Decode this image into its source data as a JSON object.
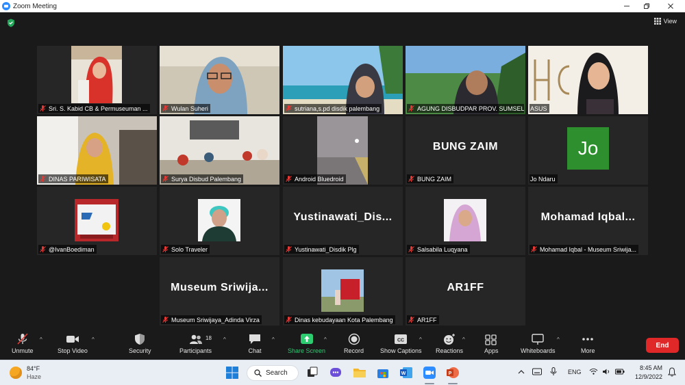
{
  "window": {
    "title": "Zoom Meeting"
  },
  "view_button": {
    "label": "View"
  },
  "tiles": [
    {
      "name": "Sri. S. Kabid CB & Permuseuman ...",
      "muted": true
    },
    {
      "name": "Wulan Suheri",
      "muted": true
    },
    {
      "name": "sutriana,s.pd disdik palembang",
      "muted": true
    },
    {
      "name": "AGUNG DISBUDPAR PROV. SUMSEL",
      "muted": true
    },
    {
      "name": "ASUS",
      "muted": false,
      "active": true
    },
    {
      "name": "DINAS PARIWISATA",
      "muted": true
    },
    {
      "name": "Surya Disbud Palembang",
      "muted": true
    },
    {
      "name": "Android Bluedroid",
      "muted": true
    },
    {
      "name": "BUNG ZAIM",
      "big": "BUNG ZAIM",
      "muted": true
    },
    {
      "name": "Jo Ndaru",
      "avatar": "Jo",
      "muted": false
    },
    {
      "name": "@IvanBoediman",
      "muted": true
    },
    {
      "name": "Solo Traveler",
      "muted": true
    },
    {
      "name": "Yustinawati_Disdik Plg",
      "big": "Yustinawati_Dis...",
      "muted": true
    },
    {
      "name": "Salsabila Luqyana",
      "muted": true
    },
    {
      "name": "Mohamad Iqbal - Museum Sriwija...",
      "big": "Mohamad  Iqbal...",
      "muted": true
    },
    {
      "name": "Museum Sriwijaya_Adinda Virza",
      "big": "Museum  Sriwija...",
      "muted": true
    },
    {
      "name": "Dinas kebudayaan Kota Palembang",
      "muted": true
    },
    {
      "name": "AR1FF",
      "big": "AR1FF",
      "muted": true
    }
  ],
  "toolbar": {
    "unmute": "Unmute",
    "stop_video": "Stop Video",
    "security": "Security",
    "participants": "Participants",
    "participants_count": "18",
    "chat": "Chat",
    "share_screen": "Share Screen",
    "record": "Record",
    "show_captions": "Show Captions",
    "reactions": "Reactions",
    "apps": "Apps",
    "whiteboards": "Whiteboards",
    "more": "More",
    "end": "End"
  },
  "taskbar": {
    "weather_temp": "84°F",
    "weather_desc": "Haze",
    "search_label": "Search",
    "language": "ENG",
    "time": "8:45 AM",
    "date": "12/9/2022"
  },
  "colors": {
    "accent_green": "#2ecc71",
    "end_red": "#e02828",
    "active_speaker": "#e8e35a",
    "avatar_green": "#2e8f2e"
  }
}
